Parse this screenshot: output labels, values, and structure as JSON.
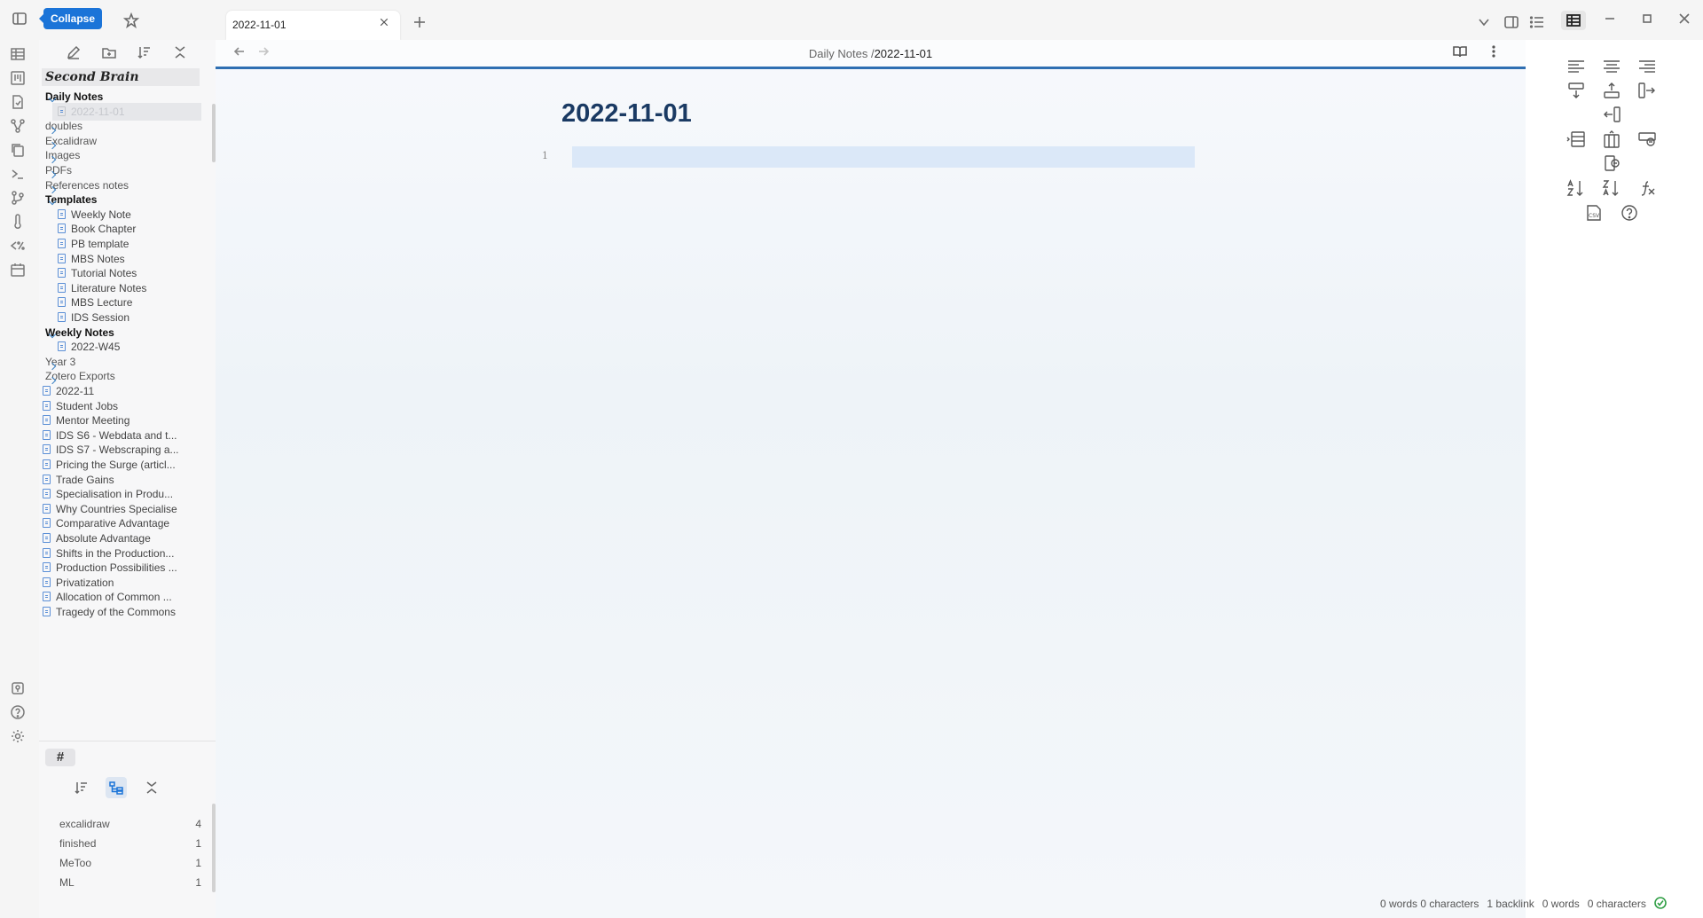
{
  "titlebar": {
    "collapse_tooltip": "Collapse",
    "active_tab": "2022-11-01"
  },
  "explorer": {
    "vault_name": "Second Brain",
    "tree": [
      {
        "label": "Daily Notes",
        "kind": "folder-open"
      },
      {
        "label": "2022-11-01",
        "kind": "file-selected"
      },
      {
        "label": "doubles",
        "kind": "folder"
      },
      {
        "label": "Excalidraw",
        "kind": "folder"
      },
      {
        "label": "Images",
        "kind": "folder"
      },
      {
        "label": "PDFs",
        "kind": "folder"
      },
      {
        "label": "References notes",
        "kind": "folder"
      },
      {
        "label": "Templates",
        "kind": "folder-open"
      },
      {
        "label": "Weekly Note",
        "kind": "child"
      },
      {
        "label": "Book Chapter",
        "kind": "child"
      },
      {
        "label": "PB template",
        "kind": "child"
      },
      {
        "label": "MBS Notes",
        "kind": "child"
      },
      {
        "label": "Tutorial Notes",
        "kind": "child"
      },
      {
        "label": "Literature Notes",
        "kind": "child"
      },
      {
        "label": "MBS Lecture",
        "kind": "child"
      },
      {
        "label": "IDS Session",
        "kind": "child"
      },
      {
        "label": "Weekly Notes",
        "kind": "folder-open"
      },
      {
        "label": "2022-W45",
        "kind": "child"
      },
      {
        "label": "Year 3",
        "kind": "folder"
      },
      {
        "label": "Zotero Exports",
        "kind": "folder"
      },
      {
        "label": "2022-11",
        "kind": "file"
      },
      {
        "label": "Student Jobs",
        "kind": "file"
      },
      {
        "label": "Mentor Meeting",
        "kind": "file"
      },
      {
        "label": "IDS S6 - Webdata and t...",
        "kind": "file"
      },
      {
        "label": "IDS S7 - Webscraping a...",
        "kind": "file"
      },
      {
        "label": "Pricing the Surge (articl...",
        "kind": "file"
      },
      {
        "label": "Trade Gains",
        "kind": "file"
      },
      {
        "label": "Specialisation in Produ...",
        "kind": "file"
      },
      {
        "label": "Why Countries Specialise",
        "kind": "file"
      },
      {
        "label": "Comparative Advantage",
        "kind": "file"
      },
      {
        "label": "Absolute Advantage",
        "kind": "file"
      },
      {
        "label": "Shifts in the Production...",
        "kind": "file"
      },
      {
        "label": "Production Possibilities ...",
        "kind": "file"
      },
      {
        "label": "Privatization",
        "kind": "file"
      },
      {
        "label": "Allocation of Common ...",
        "kind": "file"
      },
      {
        "label": "Tragedy of the Commons",
        "kind": "file"
      }
    ]
  },
  "tags": {
    "tab_label": "#",
    "items": [
      {
        "name": "excalidraw",
        "count": "4"
      },
      {
        "name": "finished",
        "count": "1"
      },
      {
        "name": "MeToo",
        "count": "1"
      },
      {
        "name": "ML",
        "count": "1"
      }
    ]
  },
  "editor": {
    "breadcrumb_folder": "Daily Notes /",
    "breadcrumb_current": "2022-11-01",
    "note_title": "2022-11-01",
    "line_number": "1"
  },
  "status_bar": {
    "words_chars_1": "0 words 0 characters",
    "backlinks": "1 backlink",
    "words": "0 words",
    "characters": "0 characters"
  },
  "colors": {
    "accent": "#1b74d8",
    "header_line": "#2f6fb2",
    "title": "#1a3a63",
    "active_line": "#dbe8f8"
  }
}
